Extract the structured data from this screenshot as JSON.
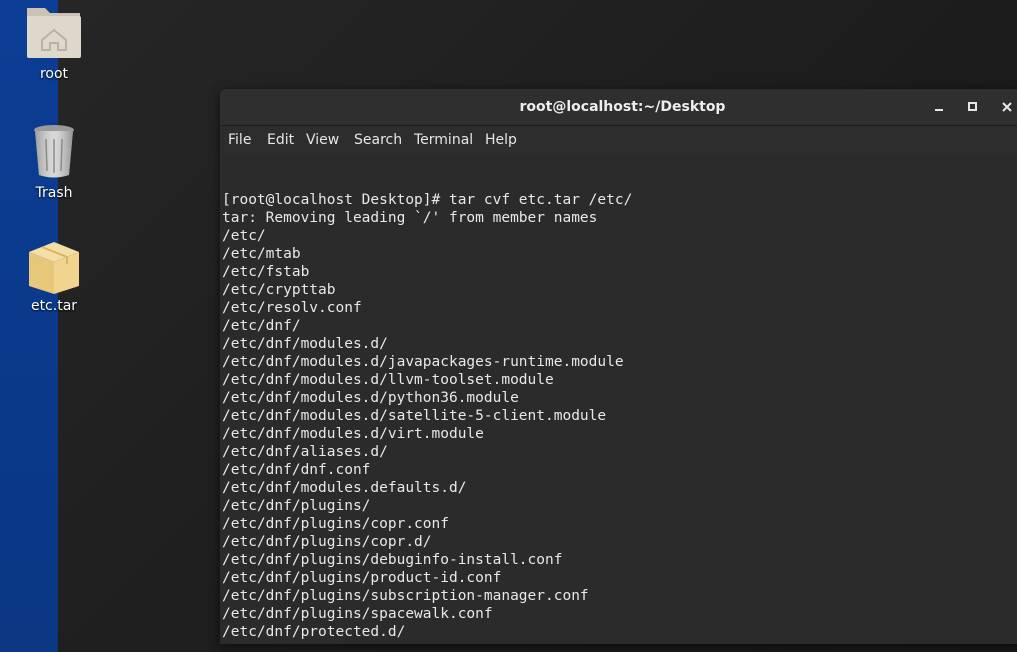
{
  "desktop": {
    "icons": [
      {
        "label": "root",
        "icon": "home-folder-icon"
      },
      {
        "label": "Trash",
        "icon": "trash-icon"
      },
      {
        "label": "etc.tar",
        "icon": "archive-icon"
      }
    ]
  },
  "window": {
    "title": "root@localhost:~/Desktop",
    "controls": {
      "minimize": "minimize-icon",
      "maximize": "maximize-icon",
      "close": "close-icon"
    }
  },
  "menu": [
    "File",
    "Edit",
    "View",
    "Search",
    "Terminal",
    "Help"
  ],
  "terminal": {
    "lines": [
      "[root@localhost Desktop]# tar cvf etc.tar /etc/",
      "tar: Removing leading `/' from member names",
      "/etc/",
      "/etc/mtab",
      "/etc/fstab",
      "/etc/crypttab",
      "/etc/resolv.conf",
      "/etc/dnf/",
      "/etc/dnf/modules.d/",
      "/etc/dnf/modules.d/javapackages-runtime.module",
      "/etc/dnf/modules.d/llvm-toolset.module",
      "/etc/dnf/modules.d/python36.module",
      "/etc/dnf/modules.d/satellite-5-client.module",
      "/etc/dnf/modules.d/virt.module",
      "/etc/dnf/aliases.d/",
      "/etc/dnf/dnf.conf",
      "/etc/dnf/modules.defaults.d/",
      "/etc/dnf/plugins/",
      "/etc/dnf/plugins/copr.conf",
      "/etc/dnf/plugins/copr.d/",
      "/etc/dnf/plugins/debuginfo-install.conf",
      "/etc/dnf/plugins/product-id.conf",
      "/etc/dnf/plugins/subscription-manager.conf",
      "/etc/dnf/plugins/spacewalk.conf",
      "/etc/dnf/protected.d/"
    ]
  }
}
